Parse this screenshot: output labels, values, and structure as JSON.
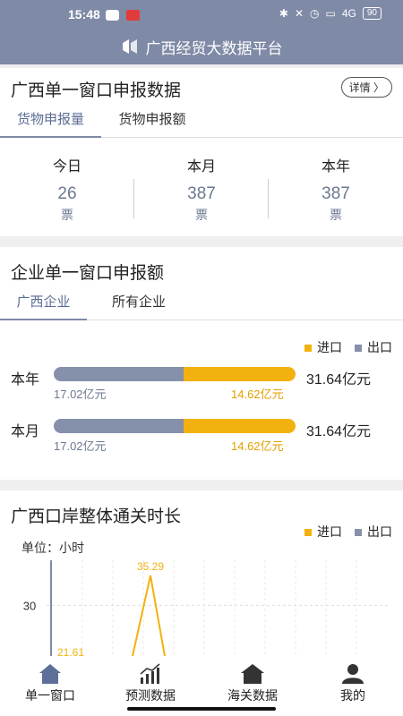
{
  "status": {
    "time": "15:48",
    "network": "4G",
    "battery": "90"
  },
  "header": {
    "title": "广西经贸大数据平台"
  },
  "card1": {
    "title": "广西单一窗口申报数据",
    "detail": "详情 〉",
    "tabs": [
      "货物申报量",
      "货物申报额"
    ],
    "stats": [
      {
        "label": "今日",
        "value": "26",
        "unit": "票"
      },
      {
        "label": "本月",
        "value": "387",
        "unit": "票"
      },
      {
        "label": "本年",
        "value": "387",
        "unit": "票"
      }
    ]
  },
  "card2": {
    "title": "企业单一窗口申报额",
    "tabs": [
      "广西企业",
      "所有企业"
    ],
    "legend": {
      "import": "进口",
      "export": "出口"
    },
    "rows": [
      {
        "label": "本年",
        "export": "17.02亿元",
        "import": "14.62亿元",
        "total": "31.64亿元",
        "export_value": 17.02,
        "import_value": 14.62
      },
      {
        "label": "本月",
        "export": "17.02亿元",
        "import": "14.62亿元",
        "total": "31.64亿元",
        "export_value": 17.02,
        "import_value": 14.62
      }
    ]
  },
  "card3": {
    "title": "广西口岸整体通关时长",
    "unit": "单位：小时",
    "legend": {
      "import": "进口",
      "export": "出口"
    }
  },
  "chart_data": {
    "type": "line",
    "ylabel": "单位：小时",
    "y_ticks": [
      "30"
    ],
    "series": [
      {
        "name": "进口",
        "values": [
          21.61,
          35.29
        ]
      }
    ],
    "ylim": [
      21,
      38
    ]
  },
  "nav": [
    {
      "label": "单一窗口",
      "icon": "home-icon"
    },
    {
      "label": "预测数据",
      "icon": "bar-chart-icon"
    },
    {
      "label": "海关数据",
      "icon": "customs-house-icon"
    },
    {
      "label": "我的",
      "icon": "user-icon"
    }
  ],
  "colors": {
    "header": "#7f8aa6",
    "import": "#f3b10f",
    "export": "#8590ab"
  }
}
